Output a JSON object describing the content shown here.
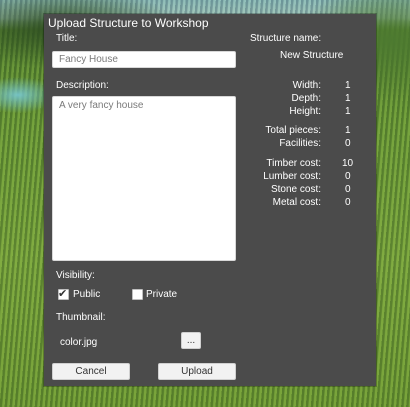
{
  "dialog": {
    "title": "Upload Structure to Workshop",
    "title_label": "Title:",
    "title_value": "Fancy House",
    "description_label": "Description:",
    "description_value": "A very fancy house",
    "visibility_label": "Visibility:",
    "visibility_options": [
      {
        "label": "Public",
        "checked": true
      },
      {
        "label": "Private",
        "checked": false
      }
    ],
    "thumbnail_label": "Thumbnail:",
    "thumbnail_file": "color.jpg",
    "browse_label": "...",
    "cancel_label": "Cancel",
    "upload_label": "Upload"
  },
  "structure": {
    "name_label": "Structure name:",
    "name_value": "New Structure",
    "dimensions": [
      {
        "label": "Width:",
        "value": "1"
      },
      {
        "label": "Depth:",
        "value": "1"
      },
      {
        "label": "Height:",
        "value": "1"
      }
    ],
    "counts": [
      {
        "label": "Total pieces:",
        "value": "1"
      },
      {
        "label": "Facilities:",
        "value": "0"
      }
    ],
    "costs": [
      {
        "label": "Timber cost:",
        "value": "10"
      },
      {
        "label": "Lumber cost:",
        "value": "0"
      },
      {
        "label": "Stone cost:",
        "value": "0"
      },
      {
        "label": "Metal cost:",
        "value": "0"
      }
    ]
  },
  "colors": {
    "panel_bg": "#4b4b4b",
    "text": "#ffffff",
    "input_bg": "#ffffff",
    "button_bg": "#f2f2f2"
  }
}
